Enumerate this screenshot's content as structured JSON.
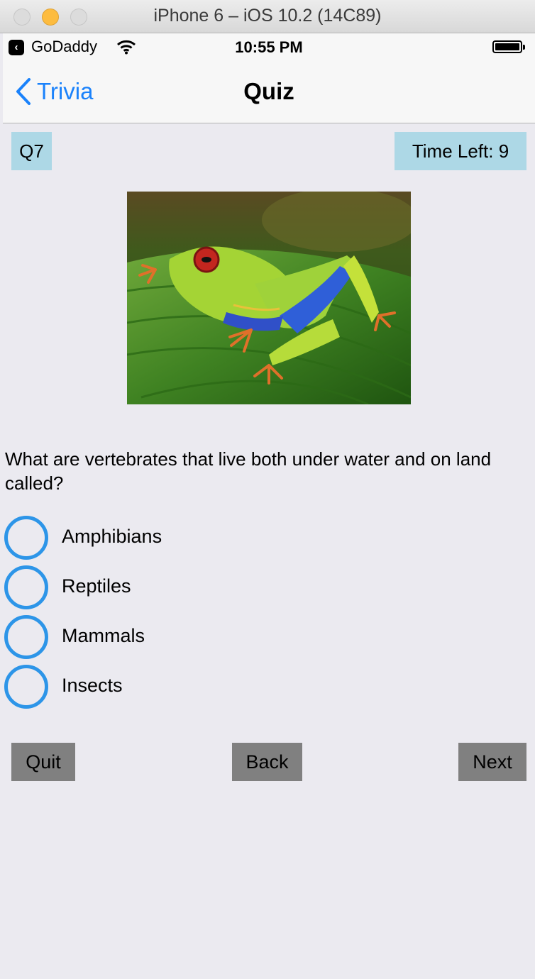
{
  "window": {
    "title": "iPhone 6 – iOS 10.2 (14C89)"
  },
  "statusbar": {
    "carrier": "GoDaddy",
    "time": "10:55 PM",
    "back_glyph": "‹"
  },
  "navbar": {
    "back_label": "Trivia",
    "title": "Quiz"
  },
  "quiz": {
    "question_number": "Q7",
    "time_left": "Time Left: 9",
    "question": "What are vertebrates that live both under water and on land called?",
    "options": [
      {
        "label": "Amphibians"
      },
      {
        "label": "Reptiles"
      },
      {
        "label": "Mammals"
      },
      {
        "label": "Insects"
      }
    ]
  },
  "buttons": {
    "quit": "Quit",
    "back": "Back",
    "next": "Next"
  },
  "colors": {
    "accent": "#1a82fb",
    "chip": "#add8e6",
    "radio": "#2d95e8",
    "button": "#808080",
    "background": "#ebeaf0"
  }
}
